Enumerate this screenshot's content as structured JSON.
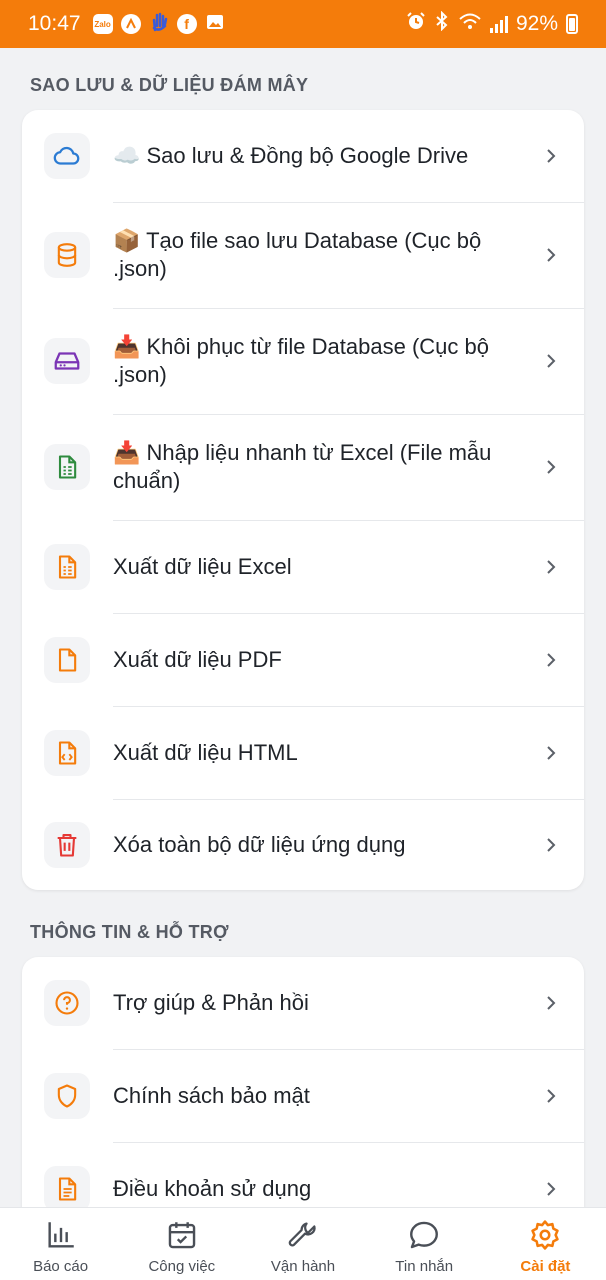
{
  "status_bar": {
    "time": "10:47",
    "battery": "92%",
    "app_icons": [
      "zalo-icon",
      "app-icon",
      "hand-icon",
      "facebook-icon",
      "image-icon"
    ]
  },
  "colors": {
    "accent": "#f47c0b",
    "blue": "#2b7bd3",
    "purple": "#7b35b5",
    "green": "#2e8b3e",
    "red": "#e53935"
  },
  "backup_section": {
    "title": "SAO LƯU & DỮ LIỆU ĐÁM MÂY",
    "items": [
      {
        "label": "☁️ Sao lưu & Đồng bộ Google Drive",
        "icon": "cloud-icon"
      },
      {
        "label": "📦 Tạo file sao lưu Database (Cục bộ .json)",
        "icon": "database-icon"
      },
      {
        "label": "📥 Khôi phục từ file Database (Cục bộ .json)",
        "icon": "hard-drive-icon"
      },
      {
        "label": "📥 Nhập liệu nhanh từ Excel (File mẫu chuẩn)",
        "icon": "spreadsheet-icon"
      },
      {
        "label": "Xuất dữ liệu Excel",
        "icon": "spreadsheet-export-icon"
      },
      {
        "label": "Xuất dữ liệu PDF",
        "icon": "file-icon"
      },
      {
        "label": "Xuất dữ liệu HTML",
        "icon": "code-file-icon"
      },
      {
        "label": "Xóa toàn bộ dữ liệu ứng dụng",
        "icon": "trash-icon"
      }
    ]
  },
  "info_section": {
    "title": "THÔNG TIN & HỖ TRỢ",
    "items": [
      {
        "label": "Trợ giúp & Phản hồi",
        "icon": "help-icon"
      },
      {
        "label": "Chính sách bảo mật",
        "icon": "shield-icon"
      },
      {
        "label": "Điều khoản sử dụng",
        "icon": "document-icon"
      }
    ]
  },
  "bottom_nav": [
    {
      "label": "Báo cáo",
      "icon": "chart-icon",
      "active": false
    },
    {
      "label": "Công việc",
      "icon": "calendar-check-icon",
      "active": false
    },
    {
      "label": "Vận hành",
      "icon": "wrench-icon",
      "active": false
    },
    {
      "label": "Tin nhắn",
      "icon": "message-icon",
      "active": false
    },
    {
      "label": "Cài đặt",
      "icon": "gear-icon",
      "active": true
    }
  ]
}
